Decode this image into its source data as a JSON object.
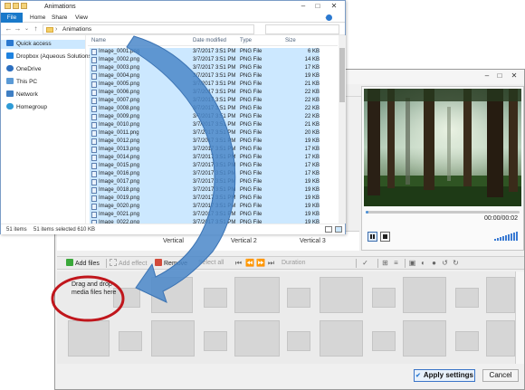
{
  "explorer": {
    "title": "Animations",
    "ribbon_tabs": [
      "File",
      "Home",
      "Share",
      "View"
    ],
    "address": "Animations",
    "nav_items": [
      {
        "label": "Quick access",
        "icon": "star-icon"
      },
      {
        "label": "Dropbox (Aqueous Solutions)",
        "icon": "dropbox-icon"
      },
      {
        "label": "OneDrive",
        "icon": "cloud-icon"
      },
      {
        "label": "This PC",
        "icon": "computer-icon"
      },
      {
        "label": "Network",
        "icon": "network-icon"
      },
      {
        "label": "Homegroup",
        "icon": "homegroup-icon"
      }
    ],
    "columns": {
      "name": "Name",
      "date": "Date modified",
      "type": "Type",
      "size": "Size"
    },
    "files": [
      {
        "name": "Image_0001.png",
        "date": "3/7/2017 3:51 PM",
        "type": "PNG File",
        "size": "6 KB"
      },
      {
        "name": "Image_0002.png",
        "date": "3/7/2017 3:51 PM",
        "type": "PNG File",
        "size": "14 KB"
      },
      {
        "name": "Image_0003.png",
        "date": "3/7/2017 3:51 PM",
        "type": "PNG File",
        "size": "17 KB"
      },
      {
        "name": "Image_0004.png",
        "date": "3/7/2017 3:51 PM",
        "type": "PNG File",
        "size": "19 KB"
      },
      {
        "name": "Image_0005.png",
        "date": "3/7/2017 3:51 PM",
        "type": "PNG File",
        "size": "21 KB"
      },
      {
        "name": "Image_0006.png",
        "date": "3/7/2017 3:51 PM",
        "type": "PNG File",
        "size": "22 KB"
      },
      {
        "name": "Image_0007.png",
        "date": "3/7/2017 3:51 PM",
        "type": "PNG File",
        "size": "22 KB"
      },
      {
        "name": "Image_0008.png",
        "date": "3/7/2017 3:51 PM",
        "type": "PNG File",
        "size": "22 KB"
      },
      {
        "name": "Image_0009.png",
        "date": "3/7/2017 3:51 PM",
        "type": "PNG File",
        "size": "22 KB"
      },
      {
        "name": "Image_0010.png",
        "date": "3/7/2017 3:51 PM",
        "type": "PNG File",
        "size": "21 KB"
      },
      {
        "name": "Image_0011.png",
        "date": "3/7/2017 3:51 PM",
        "type": "PNG File",
        "size": "20 KB"
      },
      {
        "name": "Image_0012.png",
        "date": "3/7/2017 3:51 PM",
        "type": "PNG File",
        "size": "19 KB"
      },
      {
        "name": "Image_0013.png",
        "date": "3/7/2017 3:51 PM",
        "type": "PNG File",
        "size": "17 KB"
      },
      {
        "name": "Image_0014.png",
        "date": "3/7/2017 3:51 PM",
        "type": "PNG File",
        "size": "17 KB"
      },
      {
        "name": "Image_0015.png",
        "date": "3/7/2017 3:51 PM",
        "type": "PNG File",
        "size": "17 KB"
      },
      {
        "name": "Image_0016.png",
        "date": "3/7/2017 3:51 PM",
        "type": "PNG File",
        "size": "17 KB"
      },
      {
        "name": "Image_0017.png",
        "date": "3/7/2017 3:51 PM",
        "type": "PNG File",
        "size": "19 KB"
      },
      {
        "name": "Image_0018.png",
        "date": "3/7/2017 3:51 PM",
        "type": "PNG File",
        "size": "19 KB"
      },
      {
        "name": "Image_0019.png",
        "date": "3/7/2017 3:51 PM",
        "type": "PNG File",
        "size": "19 KB"
      },
      {
        "name": "Image_0020.png",
        "date": "3/7/2017 3:51 PM",
        "type": "PNG File",
        "size": "19 KB"
      },
      {
        "name": "Image_0021.png",
        "date": "3/7/2017 3:51 PM",
        "type": "PNG File",
        "size": "19 KB"
      },
      {
        "name": "Image_0022.png",
        "date": "3/7/2017 3:51 PM",
        "type": "PNG File",
        "size": "19 KB"
      }
    ],
    "status_items": "51 items",
    "status_selected": "51 items selected  610 KB"
  },
  "editor": {
    "time": "00:00/00:02",
    "progress": 0.0,
    "transitions": [
      "Vertical",
      "Vertical 2",
      "Vertical 3"
    ],
    "toolbar": {
      "add_files": "Add files",
      "add_effect": "Add effect",
      "remove": "Remove",
      "select_all": "Select all",
      "duration": "Duration"
    },
    "drop_hint": "Drag and drop media files here",
    "apply_settings": "Apply settings",
    "cancel": "Cancel"
  },
  "colors": {
    "selection": "#cce8ff",
    "file_tab": "#1979ca",
    "arrow": "#4a87c9",
    "highlight_circle": "#c0161c",
    "apply_border": "#3a74c7"
  }
}
